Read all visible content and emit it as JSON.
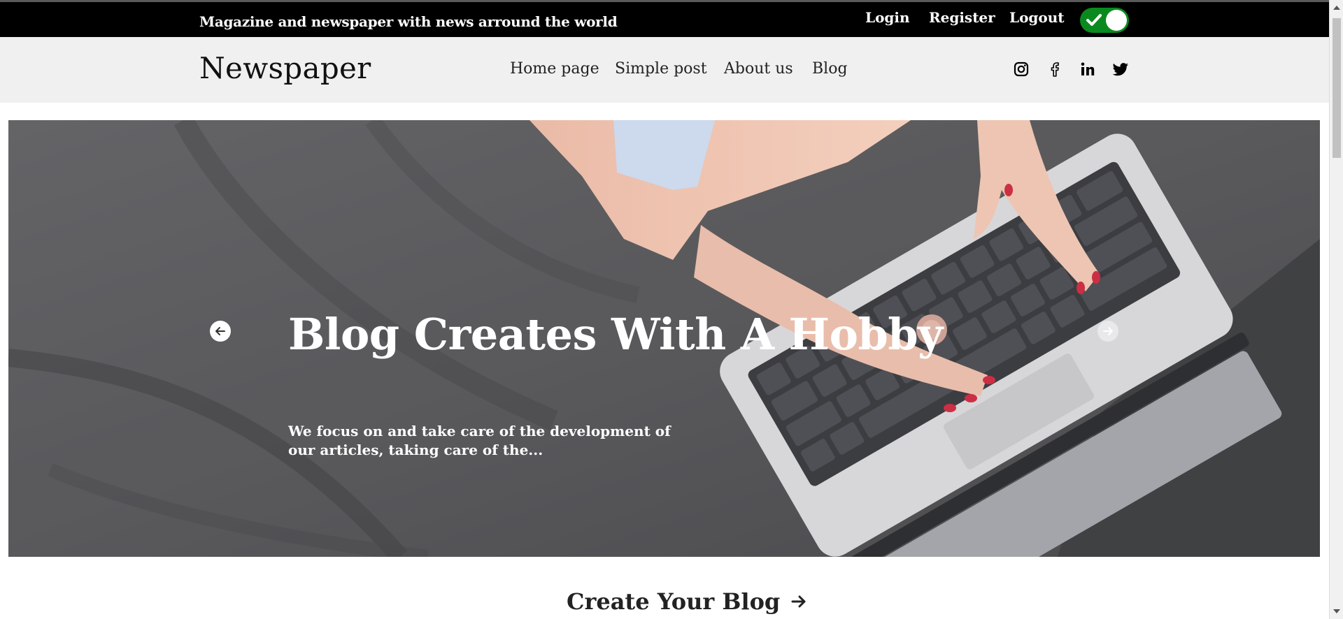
{
  "topbar": {
    "tagline": "Magazine and newspaper with news arround the world",
    "login": "Login",
    "register": "Register",
    "logout": "Logout",
    "theme_toggle_on": true,
    "toggle_color": "#0a8a1e"
  },
  "navbar": {
    "brand": "Newspaper",
    "links": [
      "Home page",
      "Simple post",
      "About us",
      "Blog"
    ],
    "social_icons": [
      "instagram-icon",
      "facebook-icon",
      "linkedin-icon",
      "twitter-icon"
    ]
  },
  "hero": {
    "title": "Blog Creates With A Hobby",
    "description": "We focus on and take care of the development of our articles, taking care of the...",
    "prev_icon": "arrow-left-icon",
    "next_icon": "arrow-right-icon"
  },
  "cta": {
    "label": "Create Your Blog",
    "icon": "arrow-right-icon"
  }
}
